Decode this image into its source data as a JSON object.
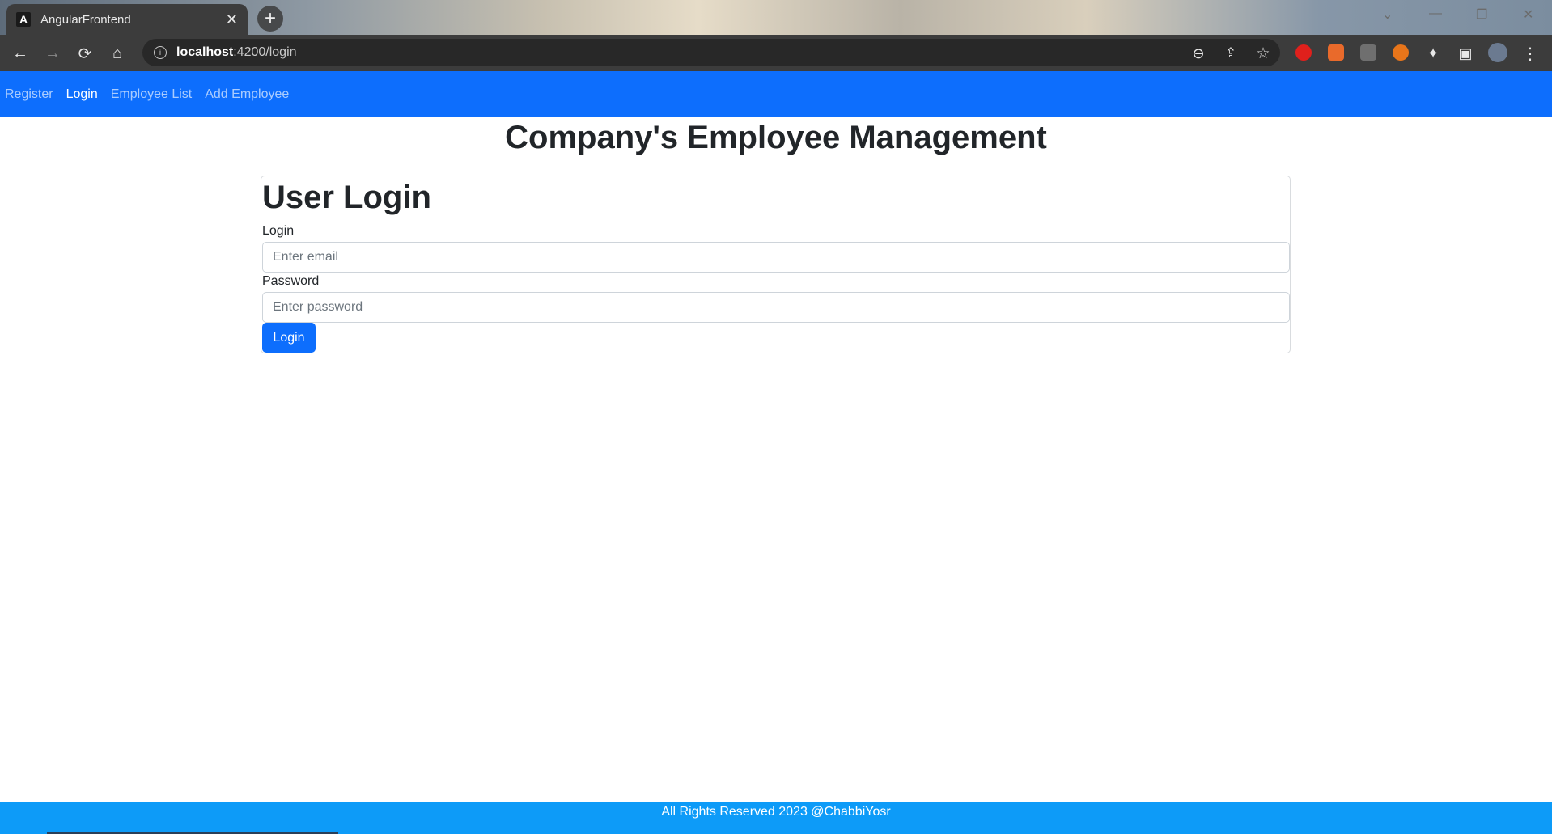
{
  "browser": {
    "tab_title": "AngularFrontend",
    "tab_favicon_letter": "A",
    "url_host": "localhost",
    "url_path": ":4200/login"
  },
  "navbar": {
    "links": [
      {
        "label": "Register"
      },
      {
        "label": "Login"
      },
      {
        "label": "Employee List"
      },
      {
        "label": "Add Employee"
      }
    ]
  },
  "page": {
    "title": "Company's Employee Management"
  },
  "login_form": {
    "heading": "User Login",
    "email_label": "Login",
    "email_placeholder": "Enter email",
    "password_label": "Password",
    "password_placeholder": "Enter password",
    "submit_label": "Login"
  },
  "footer": {
    "text": "All Rights Reserved 2023 @ChabbiYosr"
  },
  "colors": {
    "primary": "#0d6efd",
    "footer": "#0d9bf8"
  }
}
